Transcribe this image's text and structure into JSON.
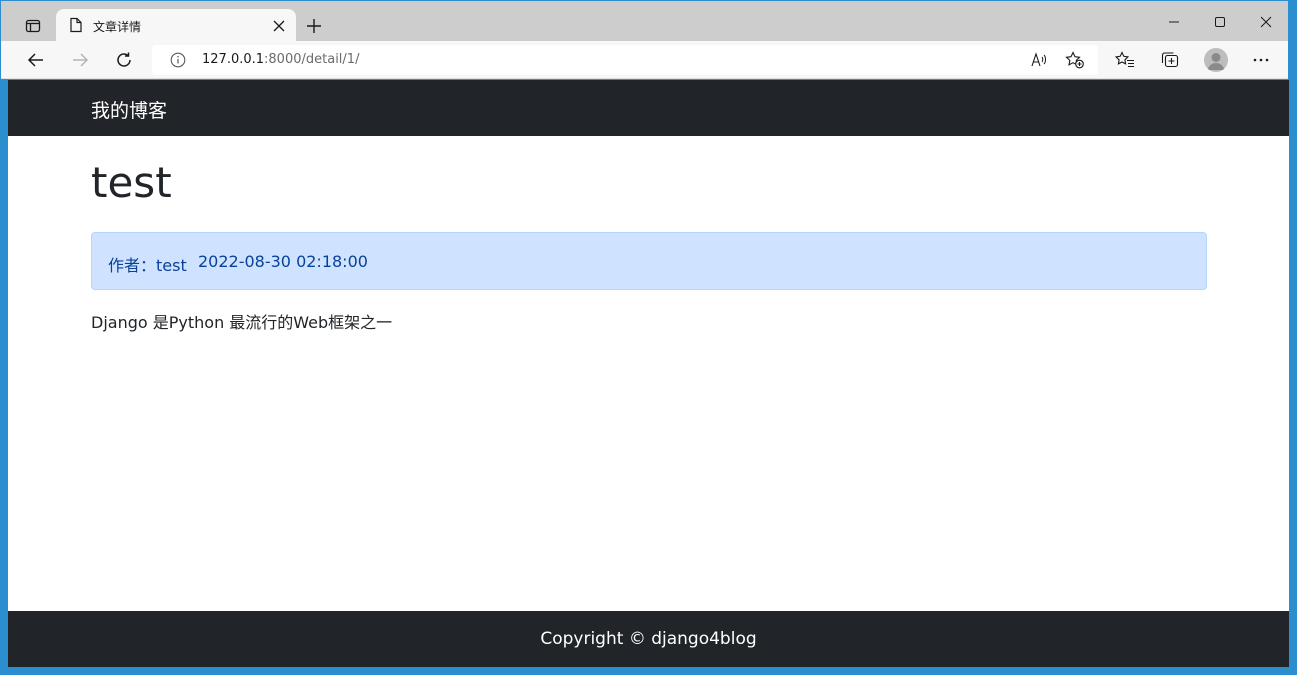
{
  "browser": {
    "tab_title": "文章详情",
    "url_host": "127.0.0.1",
    "url_rest": ":8000/detail/1/"
  },
  "site": {
    "brand": "我的博客",
    "footer": "Copyright © django4blog"
  },
  "post": {
    "title": "test",
    "author_label": "作者：test",
    "date": "2022-08-30 02:18:00",
    "body": "Django 是Python 最流行的Web框架之一"
  },
  "colors": {
    "navbar": "#212529",
    "meta_bg": "#cfe2ff",
    "meta_text": "#084298",
    "window_frame": "#2b8fcf"
  }
}
